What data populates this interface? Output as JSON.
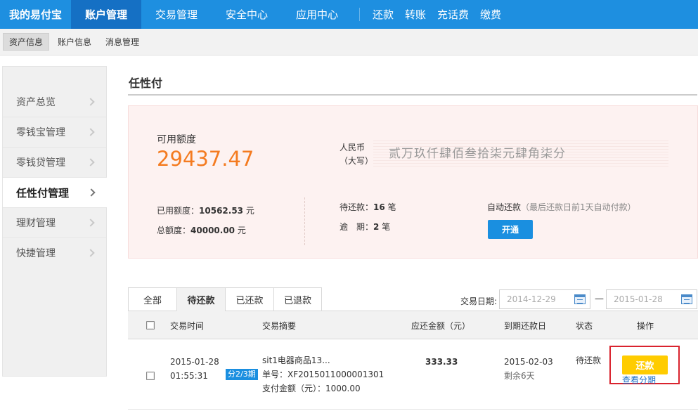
{
  "topnav": {
    "brand": "我的易付宝",
    "items": [
      {
        "label": "账户管理",
        "active": true
      },
      {
        "label": "交易管理"
      },
      {
        "label": "安全中心"
      },
      {
        "label": "应用中心"
      }
    ],
    "quick_links": [
      "还款",
      "转账",
      "充话费",
      "缴费"
    ]
  },
  "subnav": {
    "items": [
      {
        "label": "资产信息",
        "active": true
      },
      {
        "label": "账户信息"
      },
      {
        "label": "消息管理"
      }
    ]
  },
  "sidebar": {
    "items": [
      {
        "label": "资产总览"
      },
      {
        "label": "零钱宝管理"
      },
      {
        "label": "零钱贷管理"
      },
      {
        "label": "任性付管理",
        "active": true
      },
      {
        "label": "理财管理"
      },
      {
        "label": "快捷管理"
      }
    ]
  },
  "main": {
    "title": "任性付",
    "card": {
      "available_label": "可用额度",
      "available_value": "29437.47",
      "rmb_label_1": "人民币",
      "rmb_label_2": "（大写）",
      "rmb_value": "贰万玖仟肆佰叁拾柒元肆角柒分",
      "used_label": "已用额度：",
      "used_value": "10562.53",
      "used_unit": "元",
      "total_label": "总额度：",
      "total_value": "40000.00",
      "total_unit": "元",
      "pending_label": "待还款：",
      "pending_count": "16",
      "pending_unit": "笔",
      "overdue_label": "逾　期：",
      "overdue_count": "2",
      "overdue_unit": "笔",
      "auto_label": "自动还款",
      "auto_hint": "（最后还款日前1天自动付款）",
      "open_button": "开通"
    },
    "tabs": [
      {
        "label": "全部"
      },
      {
        "label": "待还款",
        "active": true
      },
      {
        "label": "已还款"
      },
      {
        "label": "已退款"
      }
    ],
    "date_filter": {
      "label": "交易日期:",
      "start": "2014-12-29",
      "end": "2015-01-28",
      "separator": "—"
    },
    "table": {
      "headers": [
        "交易时间",
        "交易摘要",
        "应还金额（元）",
        "到期还款日",
        "状态",
        "操作"
      ],
      "rows": [
        {
          "date": "2015-01-28",
          "time": "01:55:31",
          "badge": "分2/3期",
          "summary_title": "sit1电器商品13...",
          "order_no": "单号：XF2015011000001301",
          "paid": "支付金额（元）：1000.00",
          "amount": "333.33",
          "due_date": "2015-02-03",
          "remaining": "剩余6天",
          "status": "待还款",
          "repay_button": "还款",
          "view_link": "查看分期"
        }
      ]
    }
  },
  "colors": {
    "nav_blue": "#1e8fe0",
    "nav_active": "#1570c4",
    "amount_orange": "#f47b20",
    "repay_yellow": "#ffcc00",
    "highlight_red": "#d9232e"
  }
}
